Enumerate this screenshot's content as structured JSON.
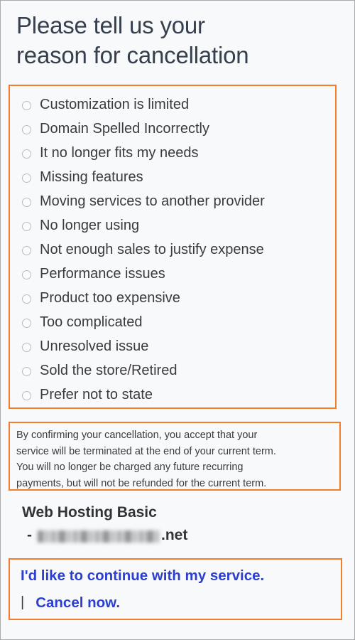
{
  "page": {
    "background_color": "#f8f9fa",
    "border_color": "#a9abad",
    "highlight_color": "#f57c28",
    "link_color": "#2b3fd2",
    "heading_color": "#363f4d"
  },
  "heading": {
    "line1": "Please tell us your",
    "line2": "reason for cancellation",
    "full": "Please tell us your reason for cancellation"
  },
  "reasons": {
    "options": [
      {
        "id": "customization-is-limited",
        "label": "Customization is limited",
        "selected": false
      },
      {
        "id": "domain-spelled-incorrectly",
        "label": "Domain Spelled Incorrectly",
        "selected": false
      },
      {
        "id": "it-no-longer-fits-my-needs",
        "label": "It no longer fits my needs",
        "selected": false
      },
      {
        "id": "missing-features",
        "label": "Missing features",
        "selected": false
      },
      {
        "id": "moving-services-to-another-provider",
        "label": "Moving services to another provider",
        "selected": false
      },
      {
        "id": "no-longer-using",
        "label": "No longer using",
        "selected": false
      },
      {
        "id": "not-enough-sales-to-justify-expense",
        "label": "Not enough sales to justify expense",
        "selected": false
      },
      {
        "id": "performance-issues",
        "label": "Performance issues",
        "selected": false
      },
      {
        "id": "product-too-expensive",
        "label": "Product too expensive",
        "selected": false
      },
      {
        "id": "too-complicated",
        "label": "Too complicated",
        "selected": false
      },
      {
        "id": "unresolved-issue",
        "label": "Unresolved issue",
        "selected": false
      },
      {
        "id": "sold-the-store-retired",
        "label": "Sold the store/Retired",
        "selected": false
      },
      {
        "id": "prefer-not-to-state",
        "label": "Prefer not to state",
        "selected": false
      }
    ]
  },
  "disclaimer": {
    "line1": "By confirming your cancellation, you accept that your",
    "line2": "service will be terminated at the end of your current term.",
    "line3": "You will no longer be charged any future recurring",
    "line4": "payments, but will not be refunded for the current term.",
    "full": "By confirming your cancellation, you accept that your service will be terminated at the end of your current term. You will no longer be charged any future recurring payments, but will not be refunded for the current term."
  },
  "product": {
    "name": "Web Hosting Basic",
    "dash": "-",
    "domain_redacted": true,
    "domain_tld": ".net"
  },
  "actions": {
    "continue_label": "I'd like to continue with my service.",
    "separator": "|",
    "cancel_label": "Cancel now."
  }
}
